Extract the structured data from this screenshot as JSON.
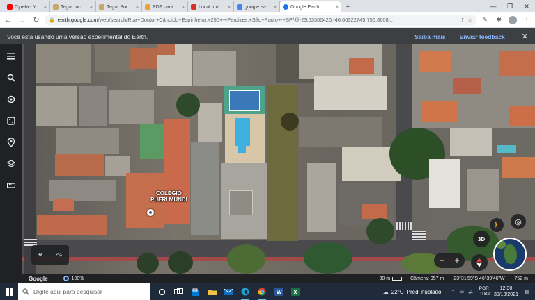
{
  "browser": {
    "tabs": [
      {
        "label": "Cyrela - YouTube",
        "favicon_color": "#ff0000"
      },
      {
        "label": "Tegra Incorporad",
        "favicon_color": "#c8a86a"
      },
      {
        "label": "Tegra Portal Corr",
        "favicon_color": "#c8a86a"
      },
      {
        "label": "PDF para TXT: Co",
        "favicon_color": "#e8a33a"
      },
      {
        "label": "Local Imóveis - Tr",
        "favicon_color": "#d93025"
      },
      {
        "label": "google earth - co",
        "favicon_color": "#4285f4"
      },
      {
        "label": "Google Earth",
        "favicon_color": "#1a73e8"
      }
    ],
    "new_tab_glyph": "+",
    "close_glyph": "×",
    "url_host": "earth.google.com",
    "url_path": "/web/search/Rua+Doutor+Cândido+Espinheira,+250+-+Perdizes,+São+Paulo+-+SP/@-23.53300426,-46.66322745,755.8608..."
  },
  "banner": {
    "message": "Você está usando uma versão experimental do Earth.",
    "link1": "Saiba mais",
    "link2": "Enviar feedback"
  },
  "sidebar": {
    "icons": [
      "menu-icon",
      "search-icon",
      "voyager-icon",
      "dice-icon",
      "pin-icon",
      "layers-icon",
      "ruler-icon"
    ]
  },
  "map": {
    "place_label": "COLÉGIO\nPUERI MUNDI",
    "controls": {
      "btn3d": "3D",
      "zoom_out": "−",
      "zoom_in": "+"
    }
  },
  "status": {
    "brand": "Google",
    "zoom": "100%",
    "scale": "30 m",
    "camera": "Câmera: 957 m",
    "coords": "23°31'59\"S 46°39'46\"W",
    "altitude": "752 m"
  },
  "taskbar": {
    "search_placeholder": "Digite aqui para pesquisar",
    "weather_temp": "22°C",
    "weather_desc": "Pred. nublado",
    "lang_line1": "POR",
    "lang_line2": "PTB2",
    "time": "12:30",
    "date": "30/10/2021"
  }
}
